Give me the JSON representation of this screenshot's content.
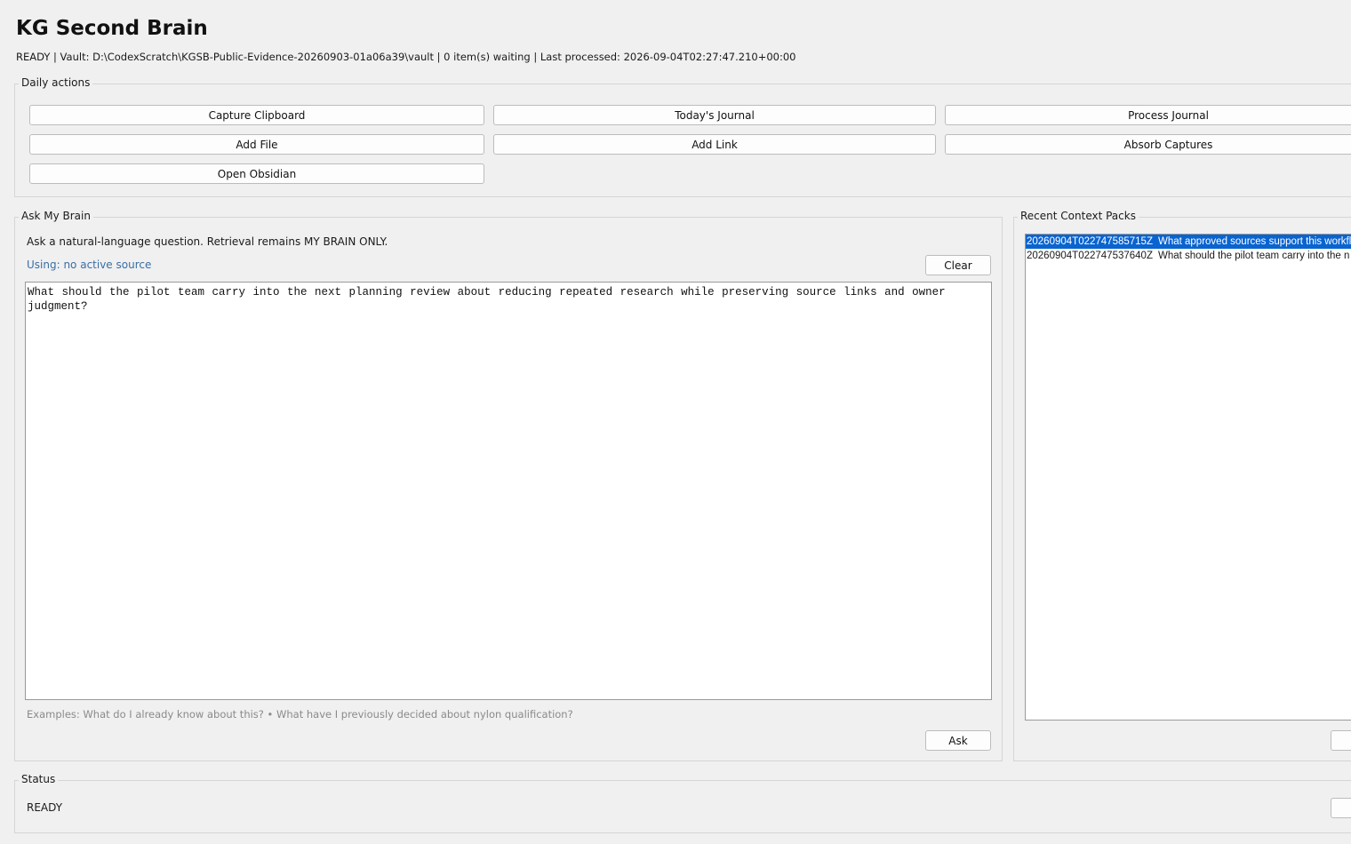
{
  "app": {
    "title": "KG Second Brain",
    "status_line": "READY  |  Vault: D:\\CodexScratch\\KGSB-Public-Evidence-20260903-01a06a39\\vault  |  0 item(s) waiting  |  Last processed: 2026-09-04T02:27:47.210+00:00"
  },
  "daily_actions": {
    "legend": "Daily actions",
    "buttons": {
      "capture_clipboard": "Capture Clipboard",
      "todays_journal": "Today's Journal",
      "process_journal": "Process Journal",
      "add_file": "Add File",
      "add_link": "Add Link",
      "absorb_captures": "Absorb Captures",
      "open_obsidian": "Open Obsidian"
    }
  },
  "ask": {
    "legend": "Ask My Brain",
    "hint": "Ask a natural-language question. Retrieval remains MY BRAIN ONLY.",
    "using": "Using: no active source",
    "clear_label": "Clear",
    "question": "What should the pilot team carry into the next planning review about reducing repeated research while preserving source links and owner judgment?",
    "examples": "Examples: What do I already know about this?  •  What have I previously decided about nylon qualification?",
    "ask_label": "Ask"
  },
  "recent": {
    "legend": "Recent Context Packs",
    "items": [
      {
        "timestamp": "20260904T022747585715Z",
        "question": "What approved sources support this workfl"
      },
      {
        "timestamp": "20260904T022747537640Z",
        "question": "What should the pilot team carry into the n"
      }
    ]
  },
  "status_section": {
    "legend": "Status",
    "text": "READY"
  },
  "colors": {
    "background": "#f0f0f0",
    "selection": "#0a64d0",
    "link": "#3a6ea5",
    "placeholder": "#8a8a8a"
  }
}
